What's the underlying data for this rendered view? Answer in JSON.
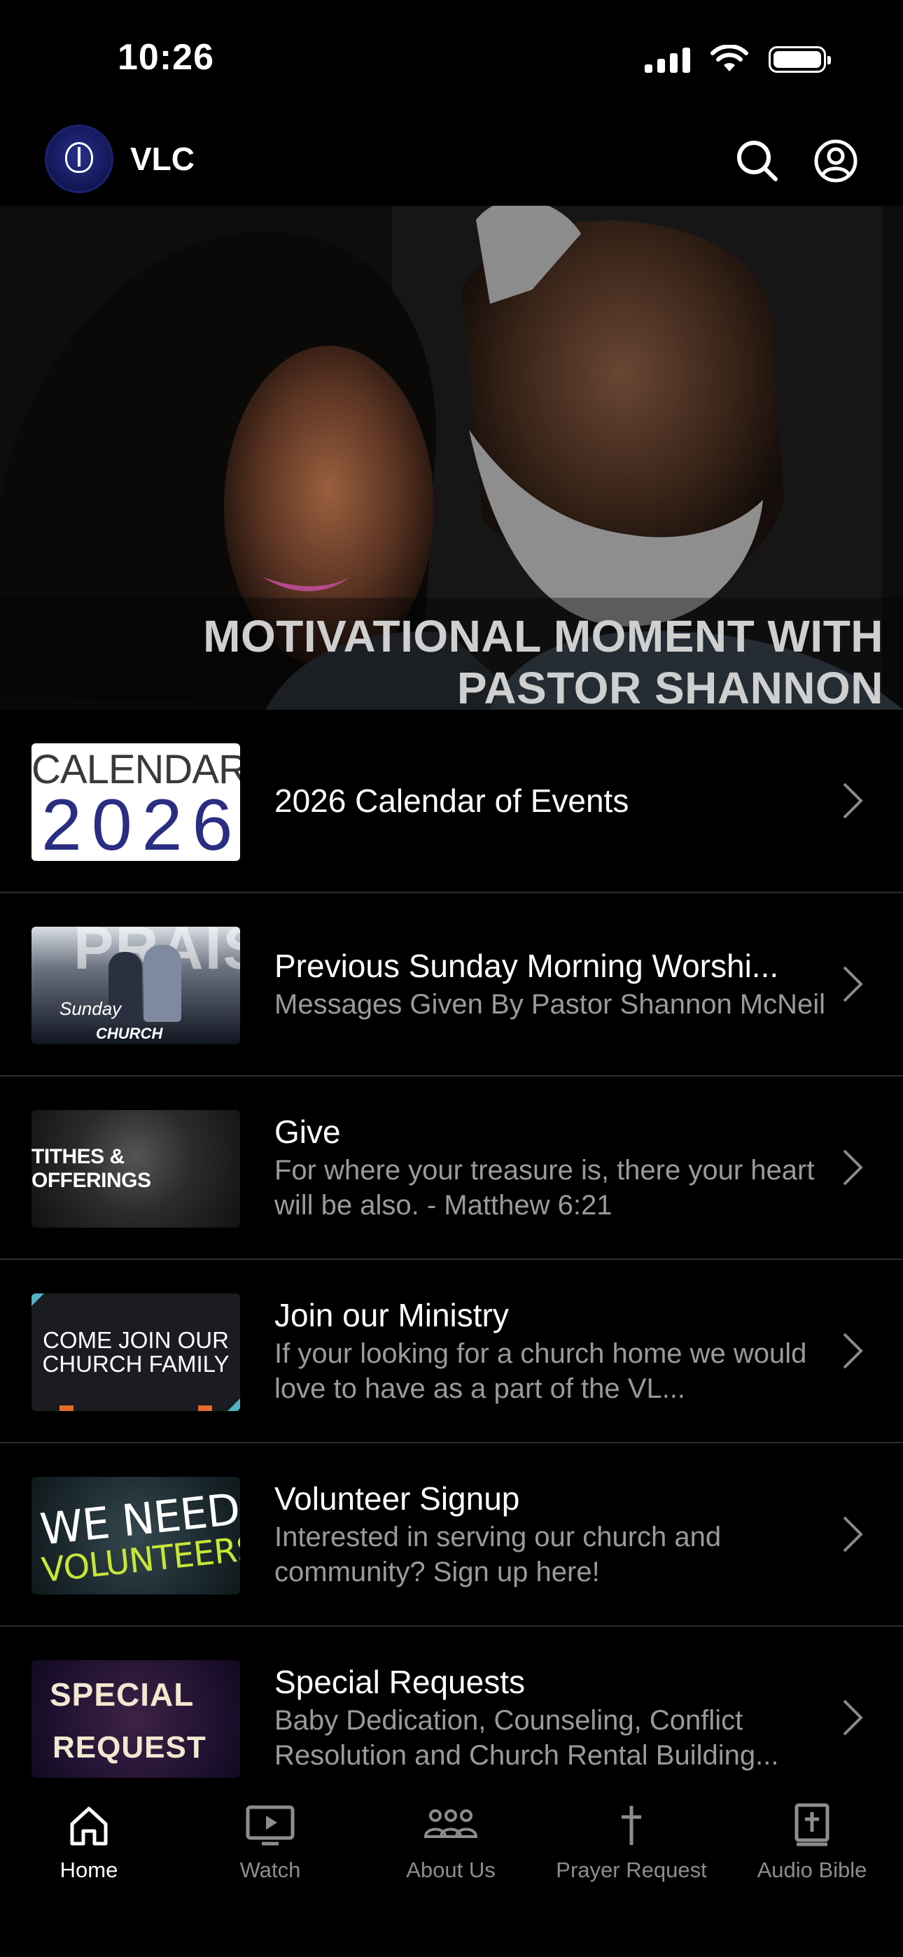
{
  "status_bar": {
    "time": "10:26"
  },
  "app_bar": {
    "title": "VLC"
  },
  "hero": {
    "title": "MOTIVATIONAL MOMENT WITH PASTOR SHANNON"
  },
  "list": [
    {
      "title": "2026 Calendar of Events",
      "subtitle": "",
      "thumb_text": [
        "CALENDAR",
        "2026"
      ]
    },
    {
      "title": "Previous Sunday Morning Worshi...",
      "subtitle": "Messages Given By Pastor Shannon McNeil",
      "thumb_text": [
        "PRAISE",
        "Sunday",
        "CHURCH WORSHIP"
      ]
    },
    {
      "title": "Give",
      "subtitle": "For where your treasure is, there your heart will be also. - Matthew 6:21",
      "thumb_text": [
        "TITHES & OFFERINGS"
      ]
    },
    {
      "title": "Join our Ministry",
      "subtitle": "If your looking for a church home we would love to have as a part of the VL...",
      "thumb_text": [
        "COME JOIN OUR CHURCH FAMILY"
      ]
    },
    {
      "title": "Volunteer Signup",
      "subtitle": "Interested in serving our church and community? Sign up here!",
      "thumb_text": [
        "WE NEED",
        "VOLUNTEERS"
      ]
    },
    {
      "title": "Special Requests",
      "subtitle": "Baby Dedication, Counseling, Conflict Resolution and Church Rental Building...",
      "thumb_text": [
        "SPECIAL",
        "REQUEST"
      ]
    }
  ],
  "tab_bar": {
    "tabs": [
      {
        "label": "Home",
        "icon": "home-icon",
        "active": true
      },
      {
        "label": "Watch",
        "icon": "tv-icon",
        "active": false
      },
      {
        "label": "About Us",
        "icon": "group-icon",
        "active": false
      },
      {
        "label": "Prayer Request",
        "icon": "cross-icon",
        "active": false
      },
      {
        "label": "Audio Bible",
        "icon": "bible-icon",
        "active": false
      }
    ]
  },
  "colors": {
    "background": "#000000",
    "secondary_text": "#9a9a9a",
    "divider": "#2d2d2d",
    "inactive_tab": "#8d8d8d"
  }
}
